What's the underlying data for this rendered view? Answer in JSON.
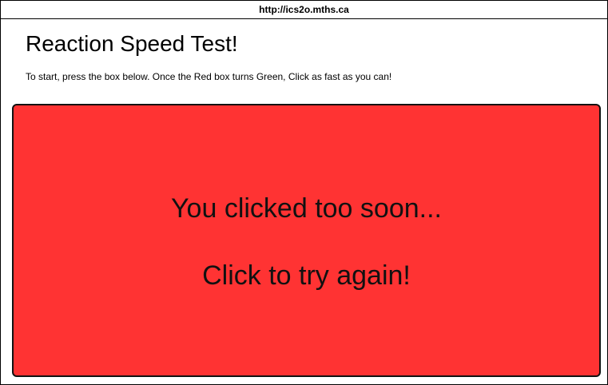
{
  "browser": {
    "url": "http://ics2o.mths.ca"
  },
  "page": {
    "title": "Reaction Speed Test!",
    "instructions": "To start, press the box below. Once the Red box turns Green, Click as fast as you can!"
  },
  "game_box": {
    "state": "too-soon",
    "color": "#ff3333",
    "message_line1": "You clicked too soon...",
    "message_line2": "Click to try again!"
  }
}
